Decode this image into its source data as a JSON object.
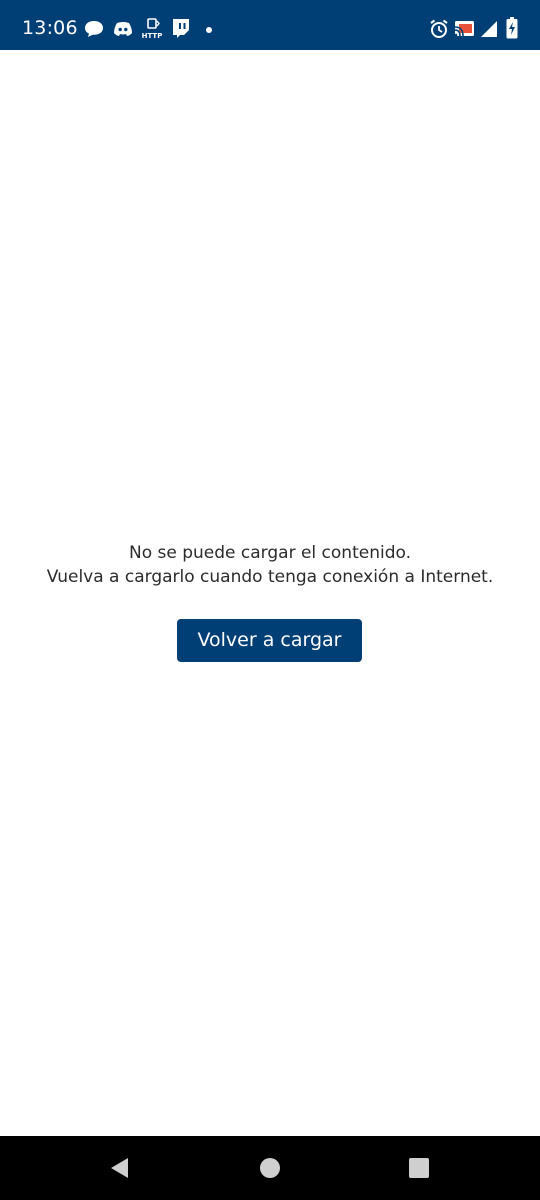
{
  "status_bar": {
    "time": "13:06",
    "bg_color": "#003f76",
    "left_icons": [
      "chat-bubble-icon",
      "discord-icon",
      "http-indicator-icon",
      "twitch-icon",
      "more-dot-icon"
    ],
    "right_icons": [
      "alarm-icon",
      "cast-icon",
      "signal-icon",
      "battery-charging-icon"
    ],
    "http_label": "HTTP"
  },
  "error": {
    "line1": "No se puede cargar el contenido.",
    "line2": "Vuelva a cargarlo cuando tenga conexión a Internet.",
    "text_color": "#2b2b2b"
  },
  "reload": {
    "label": "Volver a cargar",
    "color": "#003f76"
  },
  "nav_bar": {
    "buttons": [
      "back-icon",
      "home-icon",
      "recents-icon"
    ]
  }
}
